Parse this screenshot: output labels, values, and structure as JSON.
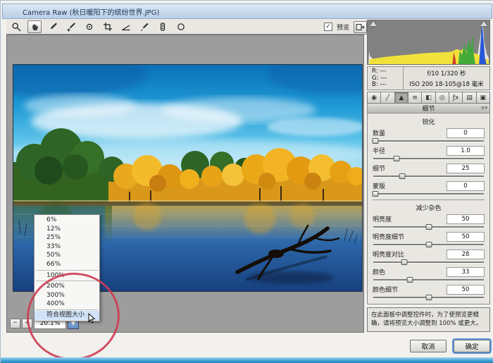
{
  "window": {
    "title": "Camera Raw (秋日暖阳下的缤纷世界.JPG)"
  },
  "toolbar": {
    "tools": [
      "zoom-tool",
      "hand-tool",
      "white-balance-tool",
      "color-sampler-tool",
      "targeted-adjustment-tool",
      "crop-tool",
      "straighten-tool",
      "spot-removal-tool",
      "red-eye-removal-tool",
      "rotate-tool"
    ],
    "active_tool": "hand-tool",
    "preview_label": "预览",
    "preview_checked": "✓"
  },
  "histogram": {
    "rgb": [
      {
        "label": "R:",
        "value": "---"
      },
      {
        "label": "G:",
        "value": "---"
      },
      {
        "label": "B:",
        "value": "---"
      }
    ],
    "line1": "f/10  1/320 秒",
    "line2": "ISO 200   18-105@18 毫米"
  },
  "tabs": [
    {
      "glyph": "◉"
    },
    {
      "glyph": "╱"
    },
    {
      "glyph": "▲"
    },
    {
      "glyph": "≡"
    },
    {
      "glyph": "◧"
    },
    {
      "glyph": "◎"
    },
    {
      "glyph": "ƒx"
    },
    {
      "glyph": "▤"
    },
    {
      "glyph": "▣"
    }
  ],
  "panel": {
    "title": "细节",
    "sharpen_heading": "锐化",
    "noise_heading": "减少杂色",
    "sharpen_sliders": [
      {
        "label": "数量",
        "value": "0",
        "pos": 2
      },
      {
        "label": "半径",
        "value": "1.0",
        "pos": 21
      },
      {
        "label": "细节",
        "value": "25",
        "pos": 26
      },
      {
        "label": "蒙版",
        "value": "0",
        "pos": 2
      }
    ],
    "noise_sliders": [
      {
        "label": "明亮度",
        "value": "50",
        "pos": 50
      },
      {
        "label": "明亮度细节",
        "value": "50",
        "pos": 50
      },
      {
        "label": "明亮度对比",
        "value": "28",
        "pos": 28
      },
      {
        "label": "颜色",
        "value": "33",
        "pos": 33
      },
      {
        "label": "颜色细节",
        "value": "50",
        "pos": 50
      }
    ],
    "note": "在此面板中调整控件时，为了使预览更精确，请将预览大小调整到 100% 或更大。"
  },
  "zoom_menu": {
    "items": [
      "6%",
      "12%",
      "25%",
      "33%",
      "50%",
      "66%",
      "100%",
      "200%",
      "300%",
      "400%",
      "符合视图大小"
    ],
    "highlighted": "符合视图大小"
  },
  "zoom_controls": {
    "minus": "−",
    "plus": "+",
    "value": "20.1%",
    "dropdown": "▼"
  },
  "footer": {
    "cancel": "取消",
    "ok": "确定"
  },
  "colors": {
    "annotation_red": "#cd3d54",
    "accent_blue": "#5b97dd",
    "histogram_yellow": "#f0e23a",
    "histogram_green": "#3aa83a",
    "histogram_blue": "#2858d8",
    "preview_bg": "#9d9d9d"
  }
}
